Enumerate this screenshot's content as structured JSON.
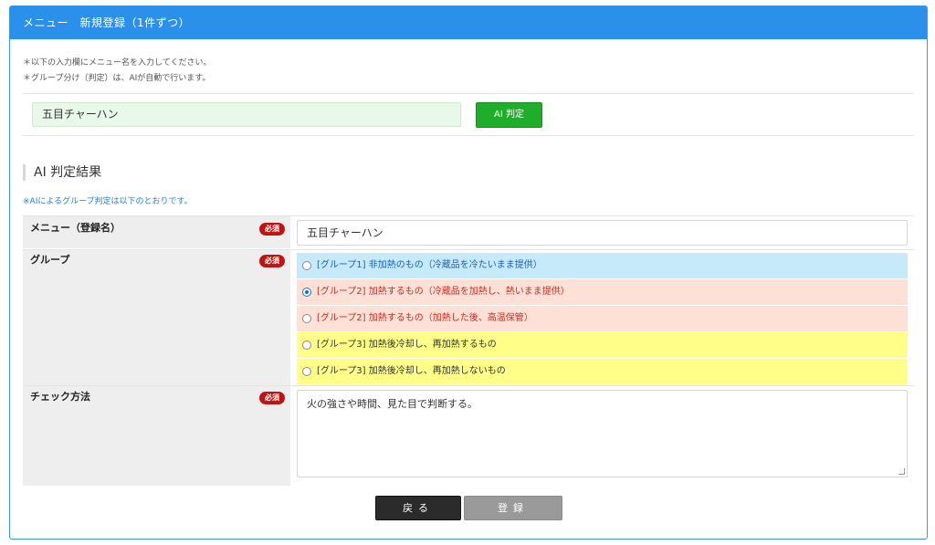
{
  "header": {
    "title": "メニュー　新規登録（1件ずつ）"
  },
  "notes": [
    "＊以下の入力欄にメニュー名を入力してください。",
    "＊グループ分け（判定）は、AIが自動で行います。"
  ],
  "menu_input": {
    "value": "五目チャーハン"
  },
  "ai_button": {
    "label": "AI 判定"
  },
  "result": {
    "title": "AI 判定結果",
    "note": "※AIによるグループ判定は以下のとおりです。"
  },
  "required_badge": "必須",
  "fields": {
    "menu_name": {
      "label": "メニュー（登録名）",
      "value": "五目チャーハン"
    },
    "group": {
      "label": "グループ",
      "options": [
        {
          "text": "[グループ1] 非加熱のもの（冷蔵品を冷たいまま提供）",
          "bg": "#c7eafb",
          "color": "#1d5fb0",
          "selected": false
        },
        {
          "text": "[グループ2] 加熱するもの（冷蔵品を加熱し、熱いまま提供）",
          "bg": "#fde0d6",
          "color": "#cc2a22",
          "selected": true
        },
        {
          "text": "[グループ2] 加熱するもの（加熱した後、高温保管）",
          "bg": "#fde0d6",
          "color": "#cc2a22",
          "selected": false
        },
        {
          "text": "[グループ3] 加熱後冷却し、再加熱するもの",
          "bg": "#fffe88",
          "color": "#333333",
          "selected": false
        },
        {
          "text": "[グループ3] 加熱後冷却し、再加熱しないもの",
          "bg": "#fffe88",
          "color": "#333333",
          "selected": false
        }
      ]
    },
    "check_method": {
      "label": "チェック方法",
      "value": "火の強さや時間、見た目で判断する。"
    }
  },
  "buttons": {
    "back": "戻る",
    "register": "登録"
  },
  "colors": {
    "header": "#2a90ea",
    "ai_button": "#1fae2a",
    "required": "#c01414"
  }
}
